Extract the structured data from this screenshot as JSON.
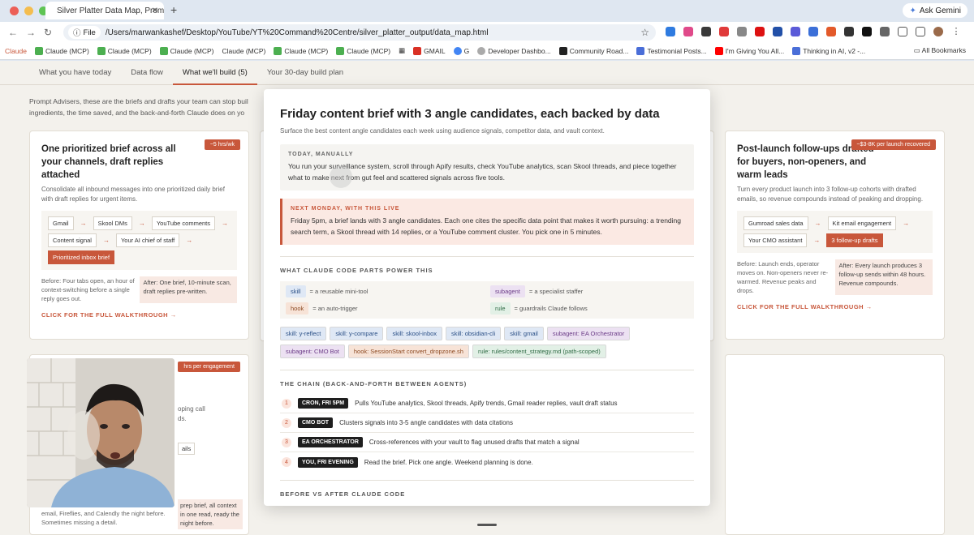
{
  "browser": {
    "tab_title": "Silver Platter Data Map, Prom",
    "ask_gemini": "Ask Gemini",
    "file_chip": "File",
    "url": "/Users/marwankashef/Desktop/YouTube/YT%20Command%20Centre/silver_platter_output/data_map.html",
    "bookmarks": [
      "Claude",
      "Claude (MCP)",
      "Claude (MCP)",
      "Claude (MCP)",
      "Claude (MCP)",
      "Claude (MCP)",
      "Claude (MCP)",
      "GMAIL",
      "G",
      "Developer Dashbo...",
      "Community Road...",
      "Testimonial Posts...",
      "I'm Giving You All...",
      "Thinking in AI, v2 -..."
    ],
    "all_bookmarks": "All Bookmarks"
  },
  "nav_tabs": [
    "What you have today",
    "Data flow",
    "What we'll build (5)",
    "Your 30-day build plan"
  ],
  "intro": "Prompt Advisers, these are the briefs and drafts your team can stop buil ingredients, the time saved, and the back-and-forth Claude does on yo",
  "card_left": {
    "badge": "~5 hrs/wk",
    "title": "One prioritized brief across all your channels, draft replies attached",
    "desc": "Consolidate all inbound messages into one prioritized daily brief with draft replies for urgent items.",
    "chips": [
      "Gmail",
      "Skool DMs",
      "YouTube comments",
      "Content signal",
      "Your AI chief of staff",
      "Prioritized inbox brief"
    ],
    "before": "Before: Four tabs open, an hour of context-switching before a single reply goes out.",
    "after": "After: One brief, 10-minute scan, draft replies pre-written.",
    "walkthrough": "CLICK FOR THE FULL WALKTHROUGH →"
  },
  "card_right": {
    "badge": "~$3-8K per launch recovered",
    "title": "Post-launch follow-ups drafted for buyers, non-openers, and warm leads",
    "desc": "Turn every product launch into 3 follow-up cohorts with drafted emails, so revenue compounds instead of peaking and dropping.",
    "chips": [
      "Gumroad sales data",
      "Kit email engagement",
      "Your CMO assistant",
      "3 follow-up drafts"
    ],
    "before": "Before: Launch ends, operator moves on. Non-openers never re-warmed. Revenue peaks and drops.",
    "after": "After: Every launch produces 3 follow-up sends within 48 hours. Revenue compounds.",
    "walkthrough": "CLICK FOR THE FULL WALKTHROUGH →"
  },
  "card_bottom_left": {
    "badge": "hrs per engagement",
    "fragments": [
      "oping call",
      "ds.",
      "ails",
      "prep brief, all context",
      "in one read, ready the night",
      "before."
    ],
    "before": "email, Fireflies, and Calendly the night before. Sometimes missing a detail."
  },
  "modal": {
    "title": "Friday content brief with 3 angle candidates, each backed by data",
    "subtitle": "Surface the best content angle candidates each week using audience signals, competitor data, and vault context.",
    "today_label": "TODAY, MANUALLY",
    "today_text": "You run your surveillance system, scroll through Apify results, check YouTube analytics, scan Skool threads, and piece together what to make next from gut feel and scattered signals across five tools.",
    "next_label": "NEXT MONDAY, WITH THIS LIVE",
    "next_text": "Friday 5pm, a brief lands with 3 angle candidates. Each one cites the specific data point that makes it worth pursuing: a trending search term, a Skool thread with 14 replies, or a YouTube comment cluster. You pick one in 5 minutes.",
    "parts_heading": "WHAT CLAUDE CODE PARTS POWER THIS",
    "legend": [
      {
        "tag": "skill",
        "text": "= a reusable mini-tool"
      },
      {
        "tag": "subagent",
        "text": "= a specialist staffer"
      },
      {
        "tag": "hook",
        "text": "= an auto-trigger"
      },
      {
        "tag": "rule",
        "text": "= guardrails Claude follows"
      }
    ],
    "parts": [
      "skill: y-reflect",
      "skill: y-compare",
      "skill: skool-inbox",
      "skill: obsidian-cli",
      "skill: gmail",
      "subagent: EA Orchestrator",
      "subagent: CMO Bot",
      "hook: SessionStart convert_dropzone.sh",
      "rule: rules/content_strategy.md (path-scoped)"
    ],
    "chain_heading": "THE CHAIN (BACK-AND-FORTH BETWEEN AGENTS)",
    "chain": [
      {
        "n": "1",
        "who": "CRON, FRI 5PM",
        "text": "Pulls YouTube analytics, Skool threads, Apify trends, Gmail reader replies, vault draft status"
      },
      {
        "n": "2",
        "who": "CMO BOT",
        "text": "Clusters signals into 3-5 angle candidates with data citations"
      },
      {
        "n": "3",
        "who": "EA ORCHESTRATOR",
        "text": "Cross-references with your vault to flag unused drafts that match a signal"
      },
      {
        "n": "4",
        "who": "YOU, FRI EVENING",
        "text": "Read the brief. Pick one angle. Weekend planning is done."
      }
    ],
    "before_after_heading": "BEFORE VS AFTER CLAUDE CODE"
  }
}
